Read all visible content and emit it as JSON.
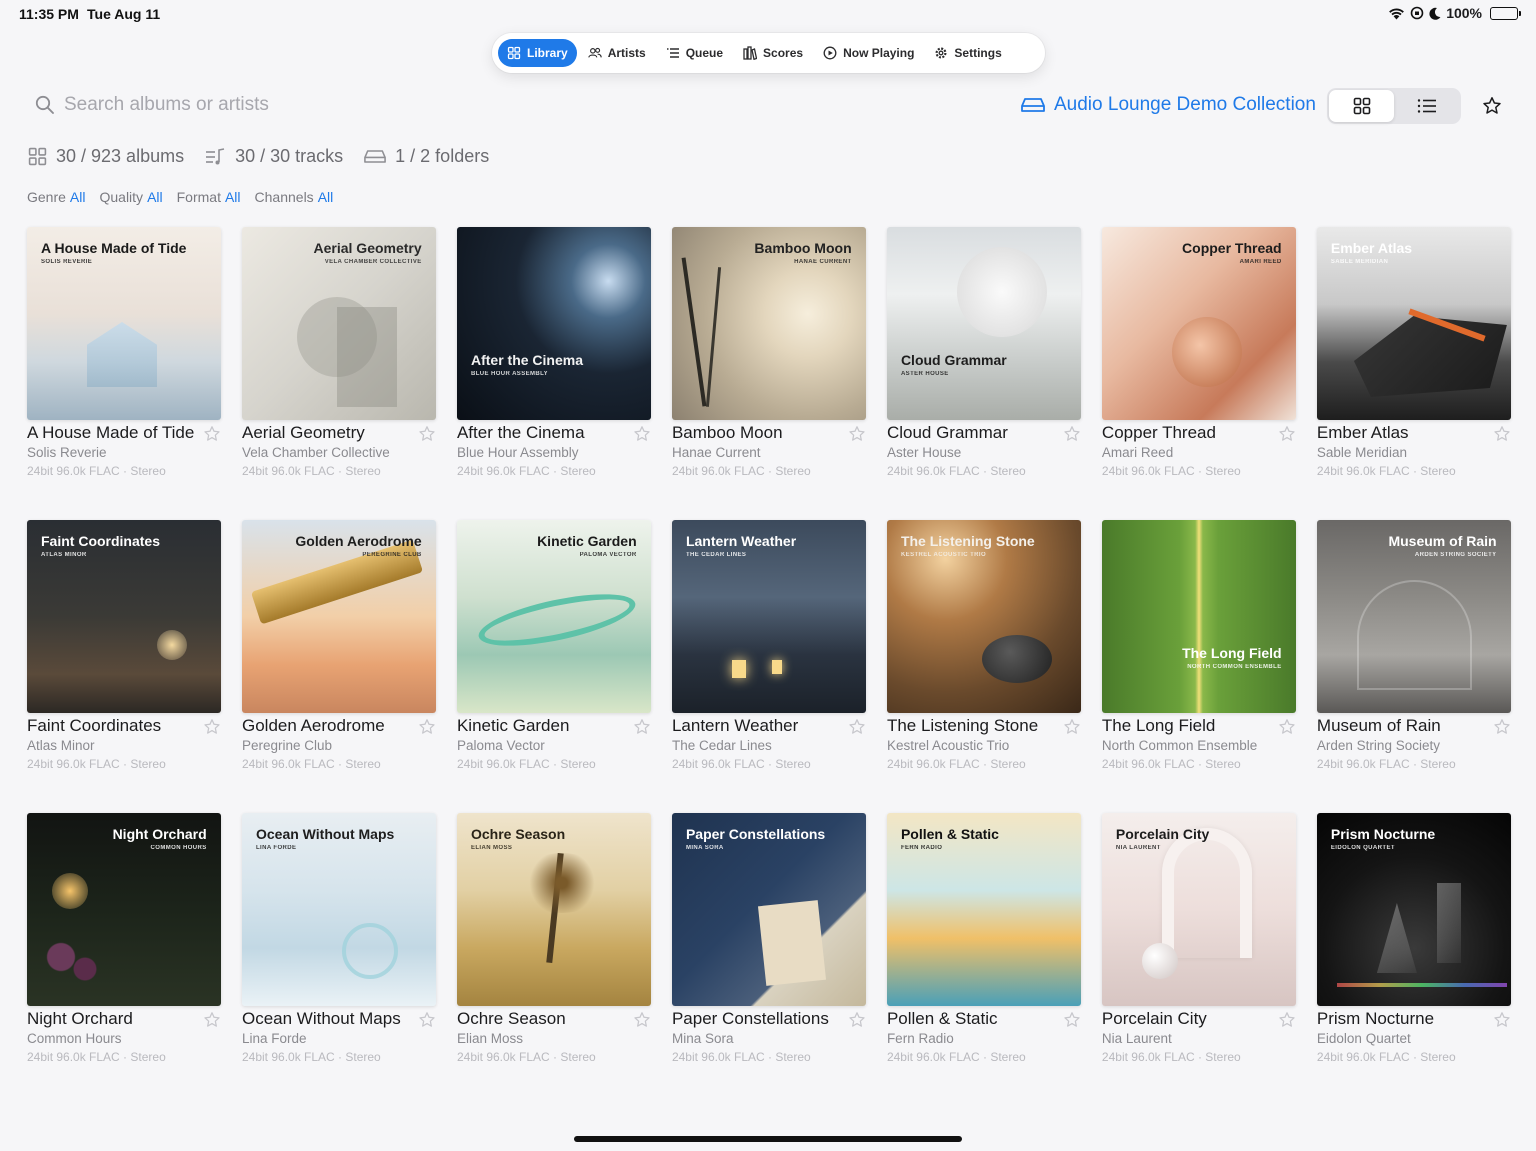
{
  "status_bar": {
    "time": "11:35 PM",
    "date": "Tue Aug 11",
    "battery": "100%"
  },
  "tabs": [
    {
      "label": "Library",
      "icon": "grid-icon",
      "active": true
    },
    {
      "label": "Artists",
      "icon": "people-icon",
      "active": false
    },
    {
      "label": "Queue",
      "icon": "queue-list-icon",
      "active": false
    },
    {
      "label": "Scores",
      "icon": "books-icon",
      "active": false
    },
    {
      "label": "Now Playing",
      "icon": "play-circle-icon",
      "active": false
    },
    {
      "label": "Settings",
      "icon": "gear-icon",
      "active": false
    }
  ],
  "search": {
    "placeholder": "Search albums or artists"
  },
  "collection": {
    "label": "Audio Lounge Demo Collection"
  },
  "stats": {
    "albums": "30 / 923 albums",
    "tracks": "30 / 30 tracks",
    "folders": "1 / 2 folders"
  },
  "filters": [
    {
      "label": "Genre",
      "value": "All"
    },
    {
      "label": "Quality",
      "value": "All"
    },
    {
      "label": "Format",
      "value": "All"
    },
    {
      "label": "Channels",
      "value": "All"
    }
  ],
  "colors": {
    "accent": "#1f7ae8",
    "background": "#f6f6f8"
  },
  "albums": [
    {
      "title": "A House Made of Tide",
      "artist": "Solis Reverie",
      "meta": "24bit 96.0k FLAC · Stereo",
      "cover_title": "A House Made of Tide",
      "cover_artist": "SOLIS REVERIE"
    },
    {
      "title": "Aerial Geometry",
      "artist": "Vela Chamber Collective",
      "meta": "24bit 96.0k FLAC · Stereo",
      "cover_title": "Aerial Geometry",
      "cover_artist": "VELA CHAMBER COLLECTIVE"
    },
    {
      "title": "After the Cinema",
      "artist": "Blue Hour Assembly",
      "meta": "24bit 96.0k FLAC · Stereo",
      "cover_title": "After the Cinema",
      "cover_artist": "BLUE HOUR ASSEMBLY"
    },
    {
      "title": "Bamboo Moon",
      "artist": "Hanae Current",
      "meta": "24bit 96.0k FLAC · Stereo",
      "cover_title": "Bamboo Moon",
      "cover_artist": "HANAE CURRENT"
    },
    {
      "title": "Cloud Grammar",
      "artist": "Aster House",
      "meta": "24bit 96.0k FLAC · Stereo",
      "cover_title": "Cloud Grammar",
      "cover_artist": "ASTER HOUSE"
    },
    {
      "title": "Copper Thread",
      "artist": "Amari Reed",
      "meta": "24bit 96.0k FLAC · Stereo",
      "cover_title": "Copper Thread",
      "cover_artist": "AMARI REED"
    },
    {
      "title": "Ember Atlas",
      "artist": "Sable Meridian",
      "meta": "24bit 96.0k FLAC · Stereo",
      "cover_title": "Ember Atlas",
      "cover_artist": "SABLE MERIDIAN"
    },
    {
      "title": "Faint Coordinates",
      "artist": "Atlas Minor",
      "meta": "24bit 96.0k FLAC · Stereo",
      "cover_title": "Faint Coordinates",
      "cover_artist": "ATLAS MINOR"
    },
    {
      "title": "Golden Aerodrome",
      "artist": "Peregrine Club",
      "meta": "24bit 96.0k FLAC · Stereo",
      "cover_title": "Golden Aerodrome",
      "cover_artist": "PEREGRINE CLUB"
    },
    {
      "title": "Kinetic Garden",
      "artist": "Paloma Vector",
      "meta": "24bit 96.0k FLAC · Stereo",
      "cover_title": "Kinetic Garden",
      "cover_artist": "PALOMA VECTOR"
    },
    {
      "title": "Lantern Weather",
      "artist": "The Cedar Lines",
      "meta": "24bit 96.0k FLAC · Stereo",
      "cover_title": "Lantern Weather",
      "cover_artist": "THE CEDAR LINES"
    },
    {
      "title": "The Listening Stone",
      "artist": "Kestrel Acoustic Trio",
      "meta": "24bit 96.0k FLAC · Stereo",
      "cover_title": "The Listening Stone",
      "cover_artist": "KESTREL ACOUSTIC TRIO"
    },
    {
      "title": "The Long Field",
      "artist": "North Common Ensemble",
      "meta": "24bit 96.0k FLAC · Stereo",
      "cover_title": "The Long Field",
      "cover_artist": "NORTH COMMON ENSEMBLE"
    },
    {
      "title": "Museum of Rain",
      "artist": "Arden String Society",
      "meta": "24bit 96.0k FLAC · Stereo",
      "cover_title": "Museum of Rain",
      "cover_artist": "ARDEN STRING SOCIETY"
    },
    {
      "title": "Night Orchard",
      "artist": "Common Hours",
      "meta": "24bit 96.0k FLAC · Stereo",
      "cover_title": "Night Orchard",
      "cover_artist": "COMMON HOURS"
    },
    {
      "title": "Ocean Without Maps",
      "artist": "Lina Forde",
      "meta": "24bit 96.0k FLAC · Stereo",
      "cover_title": "Ocean Without Maps",
      "cover_artist": "LINA FORDE"
    },
    {
      "title": "Ochre Season",
      "artist": "Elian Moss",
      "meta": "24bit 96.0k FLAC · Stereo",
      "cover_title": "Ochre Season",
      "cover_artist": "ELIAN MOSS"
    },
    {
      "title": "Paper Constellations",
      "artist": "Mina Sora",
      "meta": "24bit 96.0k FLAC · Stereo",
      "cover_title": "Paper Constellations",
      "cover_artist": "MINA SORA"
    },
    {
      "title": "Pollen & Static",
      "artist": "Fern Radio",
      "meta": "24bit 96.0k FLAC · Stereo",
      "cover_title": "Pollen & Static",
      "cover_artist": "FERN RADIO"
    },
    {
      "title": "Porcelain City",
      "artist": "Nia Laurent",
      "meta": "24bit 96.0k FLAC · Stereo",
      "cover_title": "Porcelain City",
      "cover_artist": "NIA LAURENT"
    },
    {
      "title": "Prism Nocturne",
      "artist": "Eidolon Quartet",
      "meta": "24bit 96.0k FLAC · Stereo",
      "cover_title": "Prism Nocturne",
      "cover_artist": "EIDOLON QUARTET"
    }
  ]
}
